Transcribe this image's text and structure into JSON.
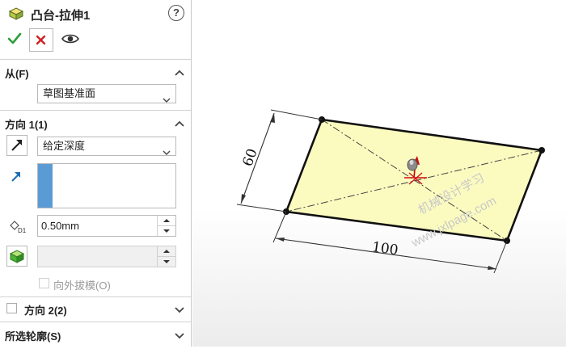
{
  "feature": {
    "title": "凸台-拉伸1",
    "help": "?"
  },
  "actions": {
    "ok_icon": "check-icon",
    "cancel_icon": "close-icon",
    "preview_icon": "eye-icon"
  },
  "from": {
    "label": "从(F)",
    "select_value": "草图基准面"
  },
  "direction1": {
    "label": "方向 1(1)",
    "end_condition": "给定深度",
    "depth_value": "0.50mm",
    "draft_label": "向外拔模(O)",
    "draft_checked": false
  },
  "direction2": {
    "label": "方向 2(2)",
    "checked": false
  },
  "selected_contours": {
    "label": "所选轮廓(S)"
  },
  "sketch": {
    "dim_width": "100",
    "dim_height": "60",
    "watermark_1": "机械设计学习",
    "watermark_2": "www.jxlpage.com"
  },
  "colors": {
    "accent": "#5b9bd5",
    "ok": "#2e9d3a",
    "cancel": "#d42020",
    "sketch_fill": "#fbfbc0"
  }
}
